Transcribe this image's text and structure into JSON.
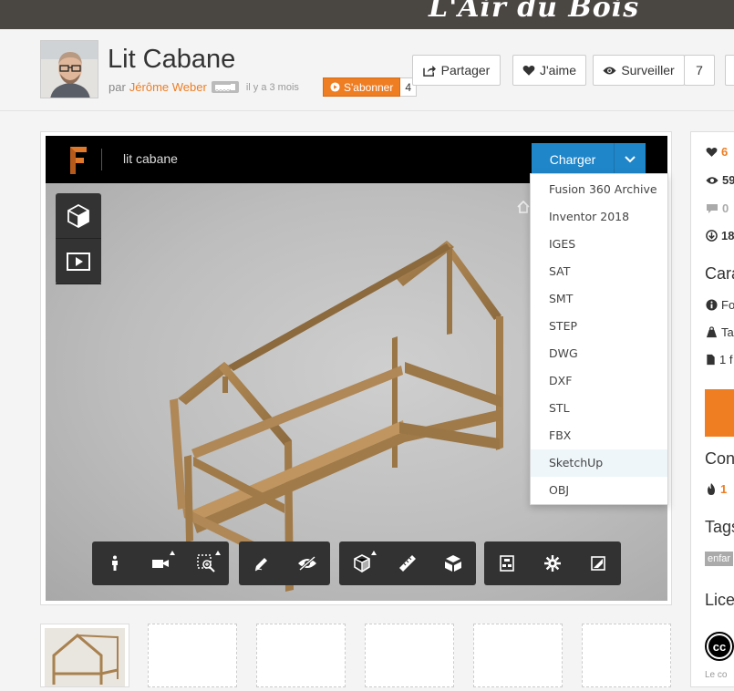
{
  "site": {
    "brand": "L'Air du Bois"
  },
  "project": {
    "title": "Lit Cabane",
    "by_prefix": "par",
    "author": "Jérôme Weber",
    "posted": "il y a 3 mois",
    "subscribe_label": "S'abonner",
    "subscribe_count": "4"
  },
  "actions": {
    "share_label": "Partager",
    "like_label": "J'aime",
    "watch_label": "Surveiller",
    "watch_count": "7"
  },
  "viewer": {
    "file_name": "lit cabane",
    "download_label": "Charger",
    "formats": [
      "Fusion 360 Archive",
      "Inventor 2018",
      "IGES",
      "SAT",
      "SMT",
      "STEP",
      "DWG",
      "DXF",
      "STL",
      "FBX",
      "SketchUp",
      "OBJ"
    ],
    "highlighted_format": "SketchUp"
  },
  "sidebar": {
    "likes": "6",
    "views": "59",
    "comments": "0",
    "downloads": "18",
    "section_carac": "Cara",
    "row_fo": "Fo",
    "row_ta": "Ta",
    "row_files": "1 f",
    "section_con": "Con",
    "hot_count": "1",
    "section_tags": "Tags",
    "tag1": "enfar",
    "section_licence": "Lice",
    "licence_note": "Le co"
  },
  "colors": {
    "accent": "#ef7d22",
    "viewer_blue": "#1f86c9",
    "topbar": "#4a4642"
  }
}
